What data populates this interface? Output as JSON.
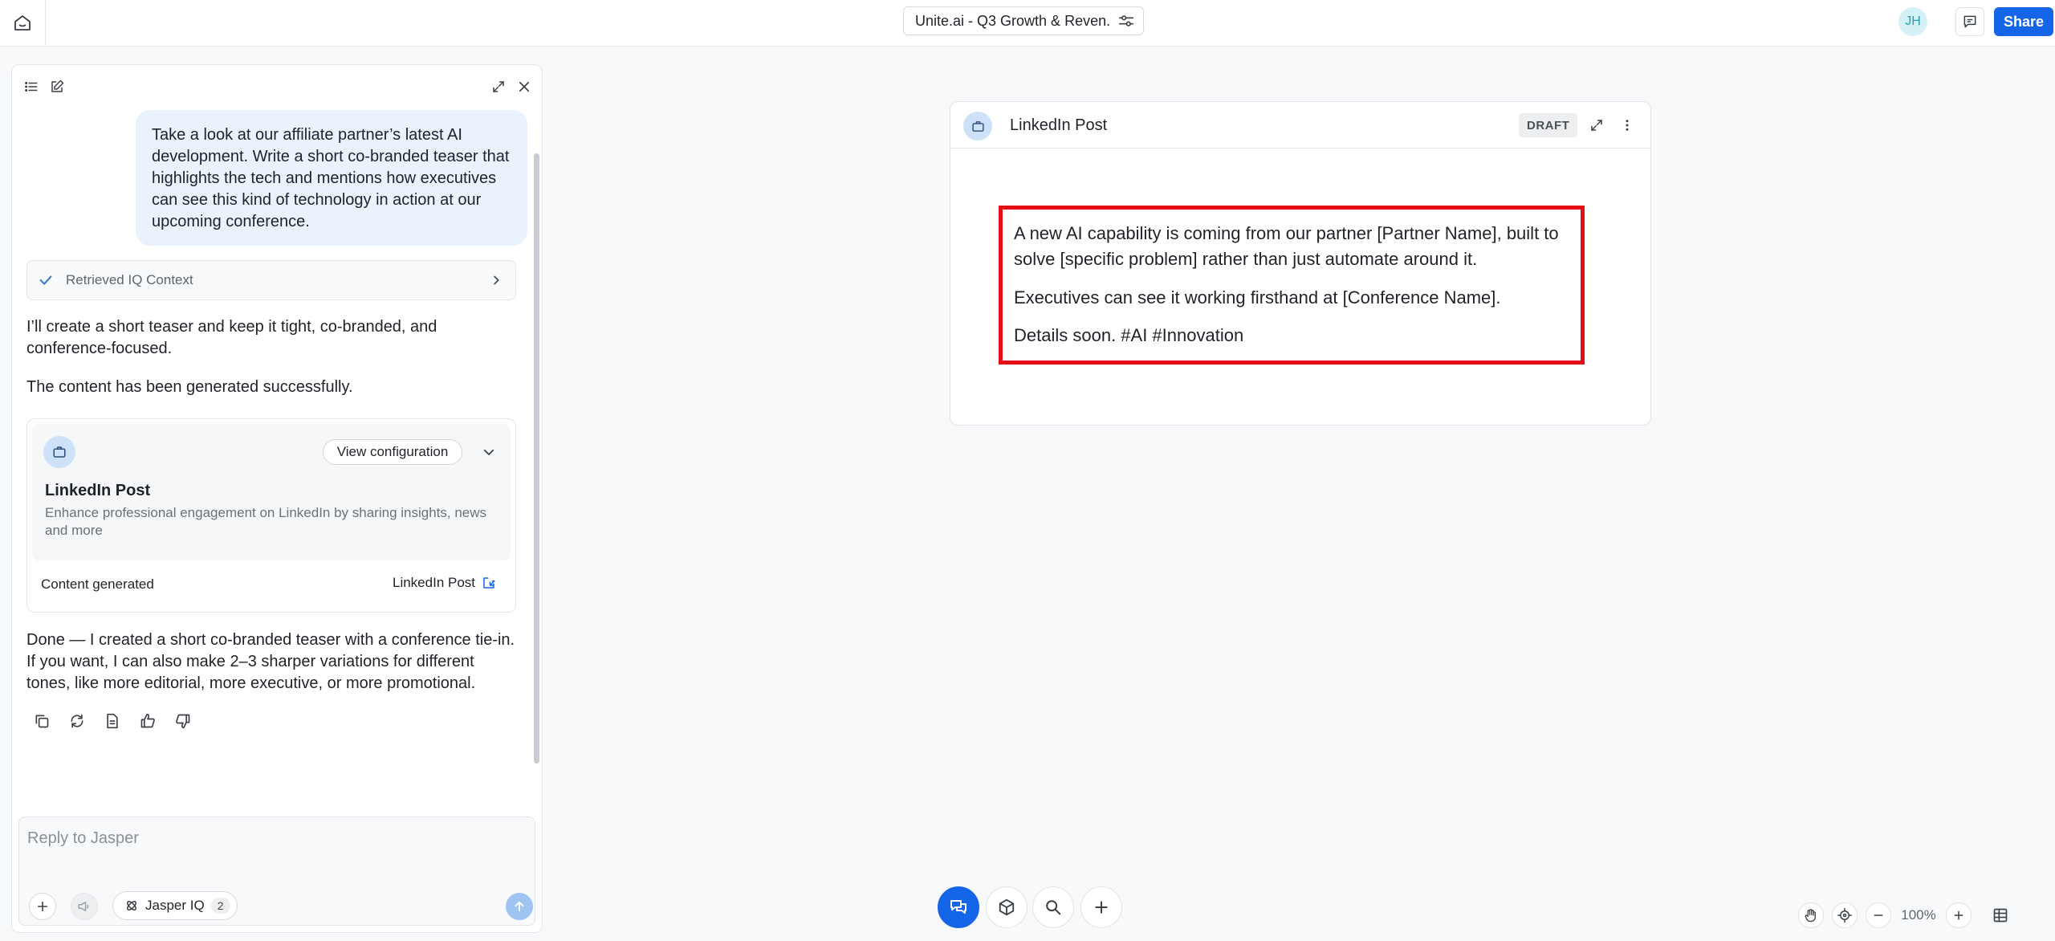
{
  "topbar": {
    "doc_title": "Unite.ai - Q3 Growth & Reven...",
    "avatar_initials": "JH",
    "share_label": "Share"
  },
  "chat": {
    "user_message": "Take a look at our affiliate partner’s latest AI development. Write a short co-branded teaser that highlights the tech and mentions how executives can see this kind of technology in action at our upcoming conference.",
    "iq_context_label": "Retrieved IQ Context",
    "ai_intro": "I’ll create a short teaser and keep it tight, co-branded, and conference-focused.",
    "ai_status": "The content has been generated successfully.",
    "result_card": {
      "view_config_label": "View configuration",
      "title": "LinkedIn Post",
      "description": "Enhance professional engagement on LinkedIn by sharing insights, news and more",
      "status": "Content generated",
      "link_label": "LinkedIn Post"
    },
    "ai_done": "Done — I created a short co-branded teaser with a conference tie-in. If you want, I can also make 2–3 sharper variations for different tones, like more editorial, more executive, or more promotional.",
    "reply_placeholder": "Reply to Jasper",
    "iq_chip_label": "Jasper IQ",
    "iq_chip_count": "2"
  },
  "document": {
    "title": "LinkedIn Post",
    "badge": "DRAFT",
    "paragraphs": [
      "A new AI capability is coming from our partner [Partner Name], built to solve [specific problem] rather than just automate around it.",
      "Executives can see it working firsthand at [Conference Name].",
      "Details soon. #AI #Innovation"
    ]
  },
  "zoom": {
    "level": "100%"
  },
  "colors": {
    "accent": "#1565e8",
    "highlight": "#e40f14",
    "user_bubble": "#eaf3fd"
  }
}
